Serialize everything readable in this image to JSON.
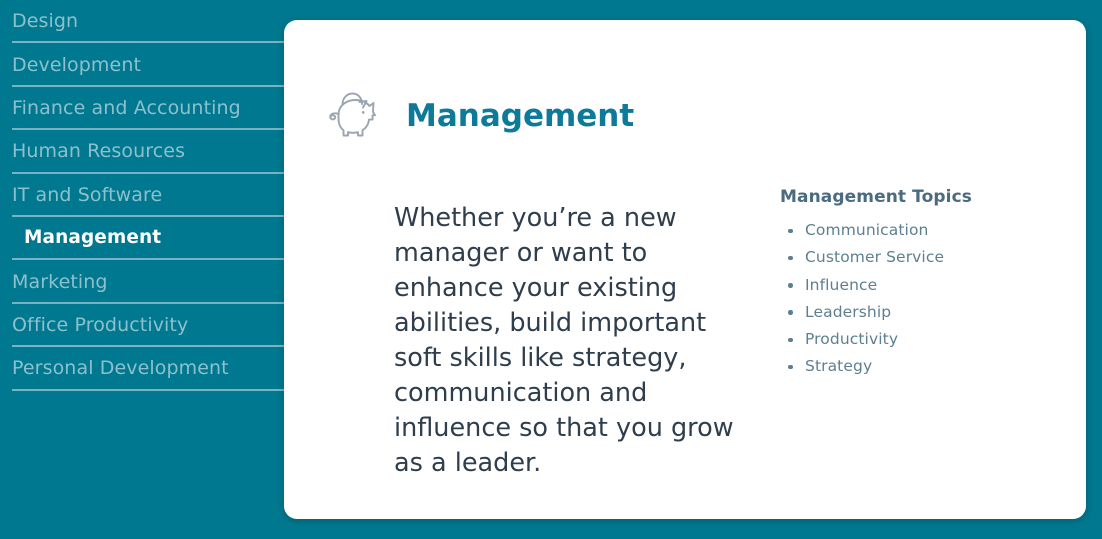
{
  "theme": {
    "background": "#00788F",
    "card_background": "#FFFFFF",
    "accent_title": "#0E7A9A",
    "nav_text": "#8DC0CD",
    "nav_selected_text": "#FFFFFF",
    "nav_divider": "#79B2C3",
    "body_text": "#2F3E4D",
    "topics_heading": "#4A6B80",
    "topics_text": "#5D7F91",
    "icon_stroke": "#9AA5B1"
  },
  "sidebar": {
    "items": [
      {
        "label": "Design",
        "selected": false
      },
      {
        "label": "Development",
        "selected": false
      },
      {
        "label": "Finance and Accounting",
        "selected": false
      },
      {
        "label": "Human Resources",
        "selected": false
      },
      {
        "label": "IT and Software",
        "selected": false
      },
      {
        "label": "Management",
        "selected": true
      },
      {
        "label": "Marketing",
        "selected": false
      },
      {
        "label": "Office Productivity",
        "selected": false
      },
      {
        "label": "Personal Development",
        "selected": false
      }
    ]
  },
  "card": {
    "icon": "piggy-bank-icon",
    "title": "Management",
    "description": "Whether you’re a new manager or want to enhance your existing abilities, build important soft skills like strategy, communication and influence so that you grow as a leader.",
    "topics": {
      "heading": "Management Topics",
      "items": [
        "Communication",
        "Customer Service",
        "Influence",
        "Leadership",
        "Productivity",
        "Strategy"
      ]
    }
  }
}
